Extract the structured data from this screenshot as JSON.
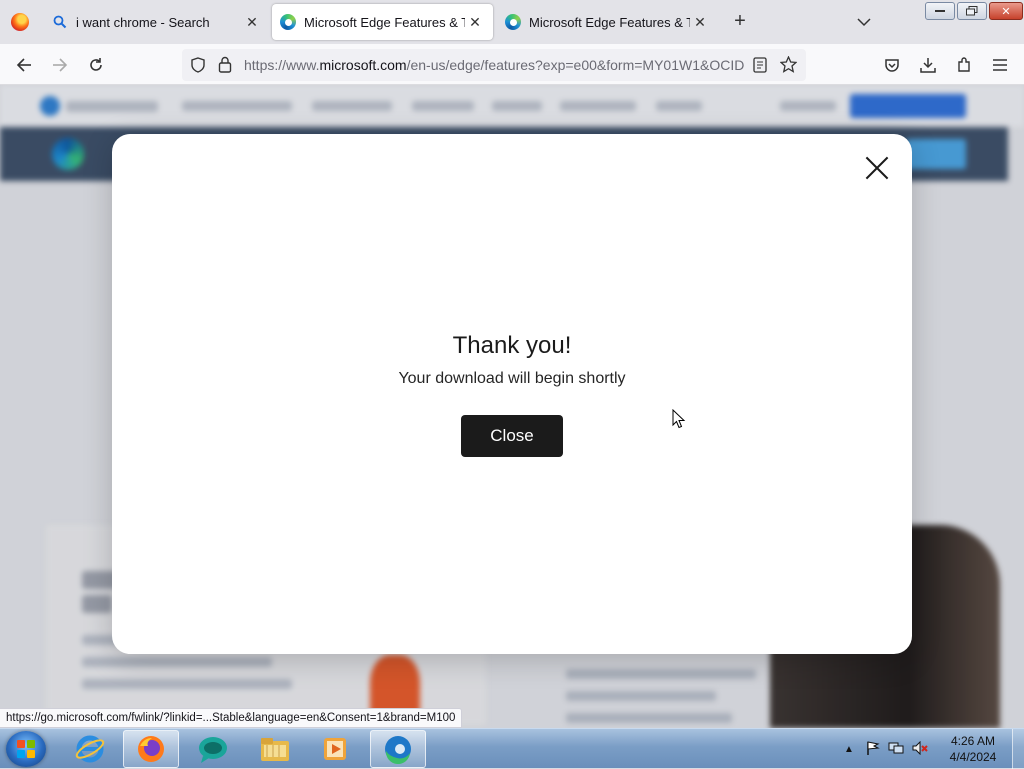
{
  "browser": {
    "tabs": [
      {
        "label": "i want chrome - Search",
        "icon": "search-icon"
      },
      {
        "label": "Microsoft Edge Features & Tips",
        "icon": "edge-icon",
        "active": true
      },
      {
        "label": "Microsoft Edge Features & Tips",
        "icon": "edge-icon"
      }
    ],
    "url_prefix": "https://www.",
    "url_domain": "microsoft.com",
    "url_rest": "/en-us/edge/features?exp=e00&form=MY01W1&OCID"
  },
  "modal": {
    "title": "Thank you!",
    "subtitle": "Your download will begin shortly",
    "close_button": "Close"
  },
  "status_link": "https://go.microsoft.com/fwlink/?linkid=...Stable&language=en&Consent=1&brand=M100",
  "taskbar": {
    "time": "4:26 AM",
    "date": "4/4/2024",
    "apps": [
      "internet-explorer-icon",
      "firefox-icon",
      "chat-icon",
      "file-explorer-icon",
      "media-player-icon",
      "edge-icon"
    ]
  },
  "colors": {
    "modal_button": "#1b1b1b",
    "hero_bar": "#3c4f68",
    "taskbar": "#7b9ec6"
  }
}
